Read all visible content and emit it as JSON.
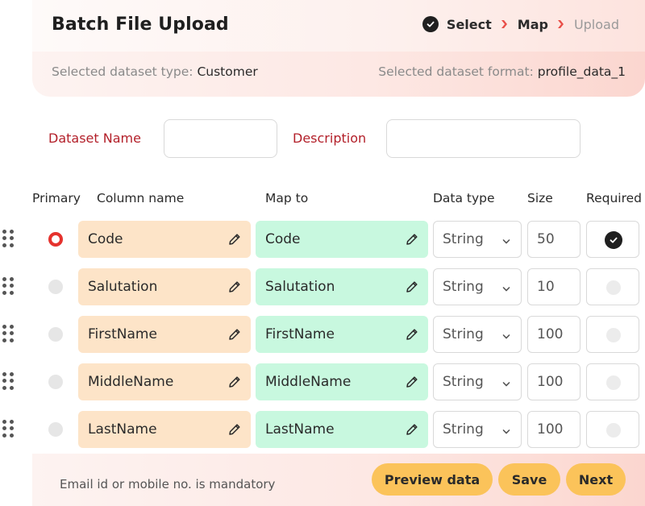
{
  "header": {
    "title": "Batch File Upload",
    "steps": [
      {
        "label": "Select",
        "state": "done"
      },
      {
        "label": "Map",
        "state": "active"
      },
      {
        "label": "Upload",
        "state": "disabled"
      }
    ],
    "dataset_type_label": "Selected dataset type:",
    "dataset_type_value": "Customer",
    "dataset_format_label": "Selected dataset format:",
    "dataset_format_value": "profile_data_1"
  },
  "form": {
    "dataset_name_label": "Dataset Name",
    "dataset_name_value": "",
    "description_label": "Description",
    "description_value": ""
  },
  "table": {
    "headers": {
      "primary": "Primary",
      "column_name": "Column name",
      "map_to": "Map to",
      "data_type": "Data type",
      "size": "Size",
      "required": "Required"
    },
    "rows": [
      {
        "primary": true,
        "column_name": "Code",
        "map_to": "Code",
        "data_type": "String",
        "size": "50",
        "required": true
      },
      {
        "primary": false,
        "column_name": "Salutation",
        "map_to": "Salutation",
        "data_type": "String",
        "size": "10",
        "required": false
      },
      {
        "primary": false,
        "column_name": "FirstName",
        "map_to": "FirstName",
        "data_type": "String",
        "size": "100",
        "required": false
      },
      {
        "primary": false,
        "column_name": "MiddleName",
        "map_to": "MiddleName",
        "data_type": "String",
        "size": "100",
        "required": false
      },
      {
        "primary": false,
        "column_name": "LastName",
        "map_to": "LastName",
        "data_type": "String",
        "size": "100",
        "required": false
      }
    ]
  },
  "footer": {
    "note": "Email id or mobile no. is mandatory",
    "preview_label": "Preview data",
    "save_label": "Save",
    "next_label": "Next"
  },
  "colors": {
    "accent_red": "#e5322d",
    "label_red": "#b3202a",
    "column_name_bg": "#fde4c8",
    "map_to_bg": "#c8f8df",
    "button_yellow": "#fbc35a"
  },
  "icons": [
    "check-icon",
    "chevron-right-icon",
    "drag-handle-icon",
    "pencil-icon",
    "chevron-down-icon"
  ]
}
